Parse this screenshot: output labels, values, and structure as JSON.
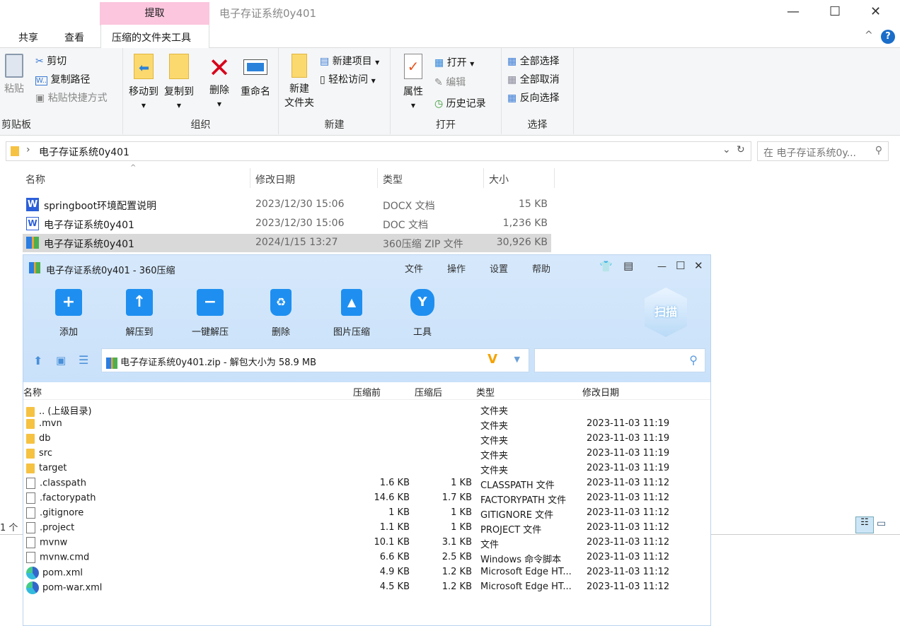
{
  "explorer": {
    "context_tab": "提取",
    "window_title": "电子存证系统0y401",
    "tabs": [
      "共享",
      "查看",
      "压缩的文件夹工具"
    ],
    "ribbon": {
      "clipboard": {
        "label": "剪贴板",
        "paste": "粘贴",
        "cut": "剪切",
        "copy_path": "复制路径",
        "paste_shortcut": "粘贴快捷方式"
      },
      "organize": {
        "label": "组织",
        "move_to": "移动到",
        "copy_to": "复制到",
        "delete": "删除",
        "rename": "重命名"
      },
      "new": {
        "label": "新建",
        "new_folder_1": "新建",
        "new_folder_2": "文件夹",
        "new_item": "新建项目",
        "easy_access": "轻松访问"
      },
      "open": {
        "label": "打开",
        "properties": "属性",
        "open": "打开",
        "edit": "编辑",
        "history": "历史记录"
      },
      "select": {
        "label": "选择",
        "select_all": "全部选择",
        "select_none": "全部取消",
        "invert": "反向选择"
      }
    },
    "address": "电子存证系统0y401",
    "search_placeholder": "在 电子存证系统0y...",
    "columns": [
      "名称",
      "修改日期",
      "类型",
      "大小"
    ],
    "files": [
      {
        "name": "springboot环境配置说明",
        "date": "2023/12/30 15:06",
        "type": "DOCX 文档",
        "size": "15 KB"
      },
      {
        "name": "电子存证系统0y401",
        "date": "2023/12/30 15:06",
        "type": "DOC 文档",
        "size": "1,236 KB"
      },
      {
        "name": "电子存证系统0y401",
        "date": "2024/1/15 13:27",
        "type": "360压缩 ZIP 文件",
        "size": "30,926 KB"
      }
    ],
    "status": "1 个"
  },
  "zip": {
    "title": "电子存证系统0y401 - 360压缩",
    "menu": [
      "文件",
      "操作",
      "设置",
      "帮助"
    ],
    "tools": [
      "添加",
      "解压到",
      "一键解压",
      "删除",
      "图片压缩",
      "工具"
    ],
    "scan": "扫描",
    "address": "电子存证系统0y401.zip - 解包大小为 58.9 MB",
    "columns": [
      "名称",
      "压缩前",
      "压缩后",
      "类型",
      "修改日期"
    ],
    "rows": [
      {
        "name": ".. (上级目录)",
        "before": "",
        "after": "",
        "type": "文件夹",
        "date": "",
        "kind": "folder"
      },
      {
        "name": ".mvn",
        "before": "",
        "after": "",
        "type": "文件夹",
        "date": "2023-11-03 11:19",
        "kind": "folder"
      },
      {
        "name": "db",
        "before": "",
        "after": "",
        "type": "文件夹",
        "date": "2023-11-03 11:19",
        "kind": "folder"
      },
      {
        "name": "src",
        "before": "",
        "after": "",
        "type": "文件夹",
        "date": "2023-11-03 11:19",
        "kind": "folder"
      },
      {
        "name": "target",
        "before": "",
        "after": "",
        "type": "文件夹",
        "date": "2023-11-03 11:19",
        "kind": "folder"
      },
      {
        "name": ".classpath",
        "before": "1.6 KB",
        "after": "1 KB",
        "type": "CLASSPATH 文件",
        "date": "2023-11-03 11:12",
        "kind": "file"
      },
      {
        "name": ".factorypath",
        "before": "14.6 KB",
        "after": "1.7 KB",
        "type": "FACTORYPATH 文件",
        "date": "2023-11-03 11:12",
        "kind": "file"
      },
      {
        "name": ".gitignore",
        "before": "1 KB",
        "after": "1 KB",
        "type": "GITIGNORE 文件",
        "date": "2023-11-03 11:12",
        "kind": "file"
      },
      {
        "name": ".project",
        "before": "1.1 KB",
        "after": "1 KB",
        "type": "PROJECT 文件",
        "date": "2023-11-03 11:12",
        "kind": "file"
      },
      {
        "name": "mvnw",
        "before": "10.1 KB",
        "after": "3.1 KB",
        "type": "文件",
        "date": "2023-11-03 11:12",
        "kind": "file"
      },
      {
        "name": "mvnw.cmd",
        "before": "6.6 KB",
        "after": "2.5 KB",
        "type": "Windows 命令脚本",
        "date": "2023-11-03 11:12",
        "kind": "file"
      },
      {
        "name": "pom.xml",
        "before": "4.9 KB",
        "after": "1.2 KB",
        "type": "Microsoft Edge HT...",
        "date": "2023-11-03 11:12",
        "kind": "edge"
      },
      {
        "name": "pom-war.xml",
        "before": "4.5 KB",
        "after": "1.2 KB",
        "type": "Microsoft Edge HT...",
        "date": "2023-11-03 11:12",
        "kind": "edge"
      }
    ]
  }
}
